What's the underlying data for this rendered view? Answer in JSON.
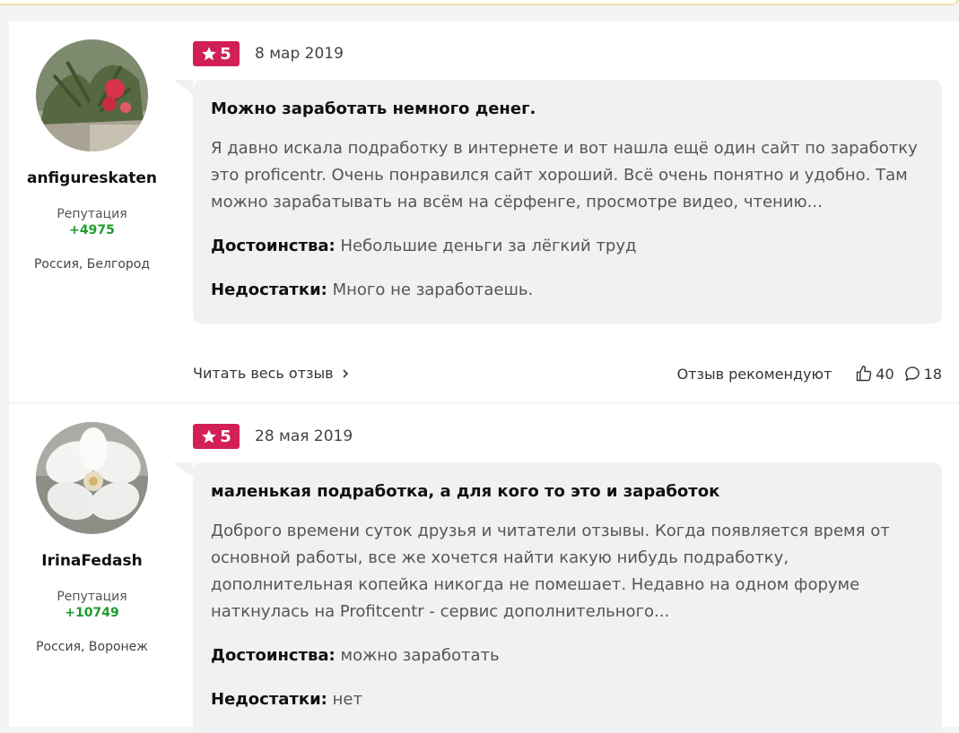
{
  "reviews": [
    {
      "author": {
        "name": "anfigureskaten",
        "reputation_label": "Репутация",
        "reputation": "+4975",
        "location": "Россия, Белгород"
      },
      "rating": "5",
      "date": "8 мар 2019",
      "title": "Можно заработать немного денег.",
      "text": "Я давно искала подработку в интернете и вот нашла ещё один сайт по заработку это proficentr. Очень понравился сайт хороший. Всё очень понятно и удобно. Там можно зарабатывать на всём на сёрфенге, просмотре видео, чтению...",
      "pros_label": "Достоинства:",
      "pros": "Небольшие деньги за лёгкий труд",
      "cons_label": "Недостатки:",
      "cons": "Много не заработаешь.",
      "read_more": "Читать весь отзыв",
      "recommend_label": "Отзыв рекомендуют",
      "likes": "40",
      "comments": "18"
    },
    {
      "author": {
        "name": "IrinaFedash",
        "reputation_label": "Репутация",
        "reputation": "+10749",
        "location": "Россия, Воронеж"
      },
      "rating": "5",
      "date": "28 мая 2019",
      "title": "маленькая подработка, а для кого то это и заработок",
      "text": "Доброго времени суток друзья и читатели отзывы. Когда появляется время от основной работы, все же хочется найти какую нибудь подработку, дополнительная копейка никогда не помешает. Недавно на одном форуме наткнулась на Profitcentr - сервис дополнительного...",
      "pros_label": "Достоинства:",
      "pros": "можно заработать",
      "cons_label": "Недостатки:",
      "cons": "нет"
    }
  ],
  "colors": {
    "badge": "#d21f58",
    "reputation": "#1f9d2f",
    "bubble": "#f1f1f3"
  },
  "icons": [
    "star-icon",
    "chevron-right-icon",
    "thumbs-up-icon",
    "comment-icon"
  ]
}
